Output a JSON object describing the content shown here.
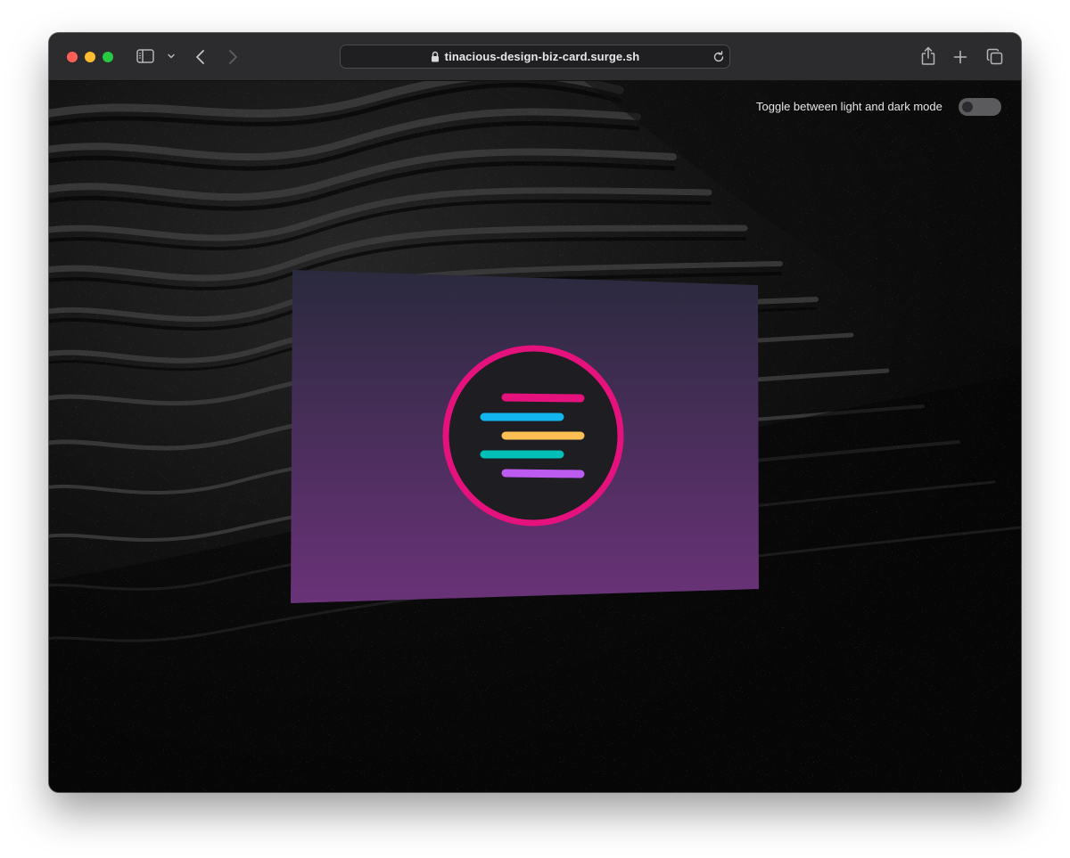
{
  "browser": {
    "url": "tinacious-design-biz-card.surge.sh",
    "icons": {
      "close": "close-dot",
      "minimize": "minimize-dot",
      "maximize": "maximize-dot",
      "sidebar": "sidebar-icon",
      "chevron": "chevron-down-icon",
      "back": "back-arrow-icon",
      "forward": "forward-arrow-icon",
      "lock": "lock-icon",
      "reload": "reload-icon",
      "share": "share-icon",
      "new_tab": "plus-icon",
      "tabs": "tabs-overview-icon"
    },
    "traffic_colors": {
      "close": "#ff5f57",
      "minimize": "#febc2e",
      "maximize": "#28c840"
    }
  },
  "page": {
    "toggle_label": "Toggle between light and dark mode",
    "toggle_state": "dark",
    "card": {
      "gradient_top": "#2a2a3e",
      "gradient_bottom": "#6a3278",
      "logo": {
        "ring_color": "#e5127d",
        "face_color": "#1d1d22",
        "bars": [
          {
            "color": "#e5127d"
          },
          {
            "color": "#13b5f0"
          },
          {
            "color": "#fcbf53"
          },
          {
            "color": "#00c0b7"
          },
          {
            "color": "#bd5bf0"
          }
        ]
      }
    }
  }
}
